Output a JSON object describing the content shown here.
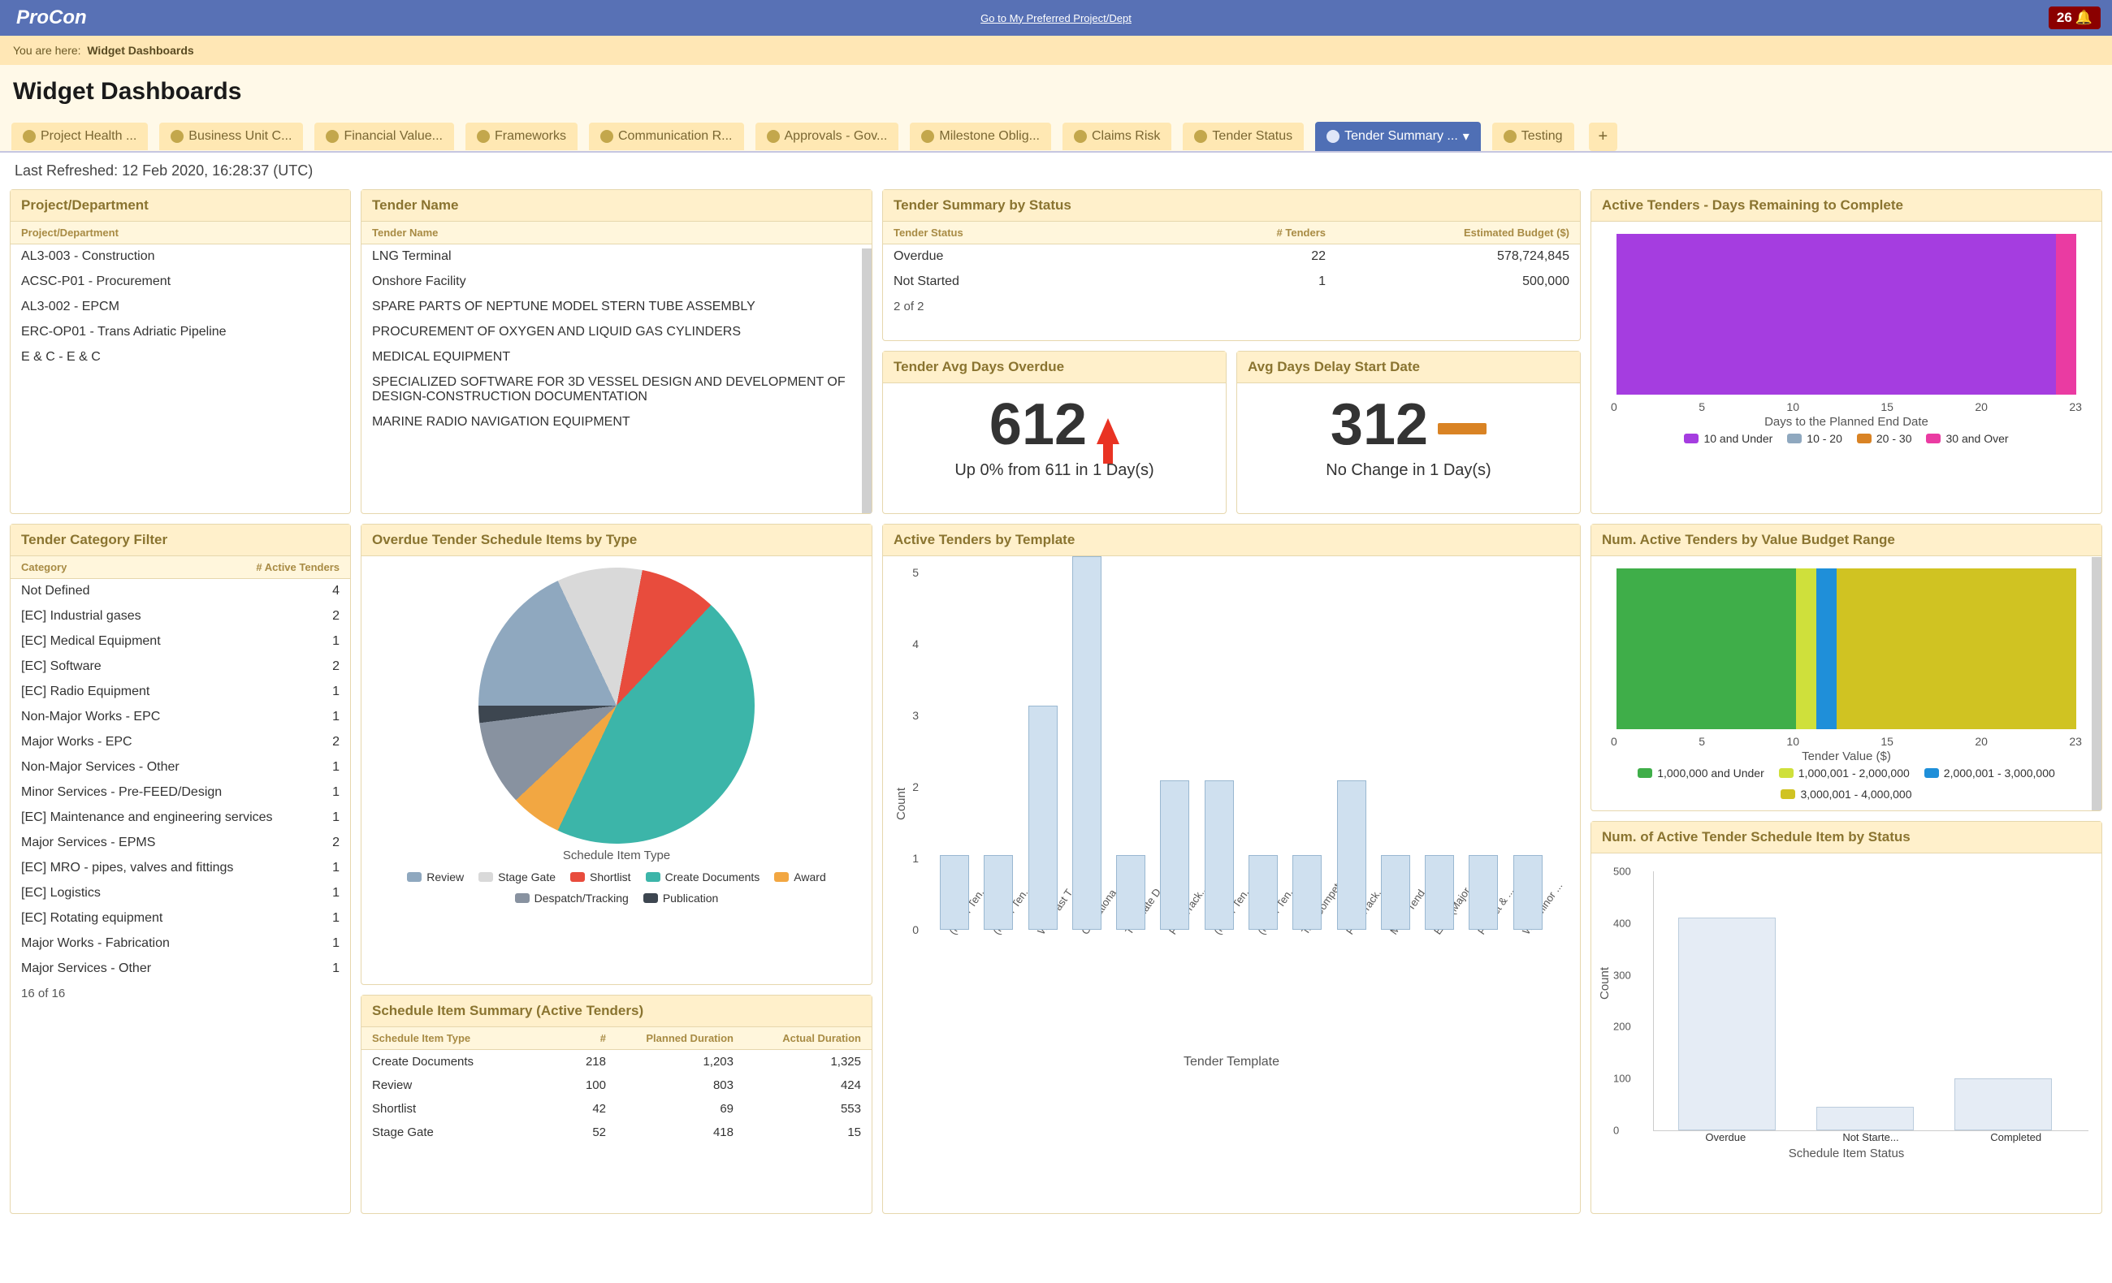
{
  "header": {
    "brand": "ProCon",
    "centerLink": "Go to My Preferred Project/Dept",
    "notifCount": "26"
  },
  "breadcrumb": {
    "prefix": "You are here:",
    "current": "Widget Dashboards"
  },
  "pageTitle": "Widget Dashboards",
  "tabs": [
    {
      "label": "Project Health ..."
    },
    {
      "label": "Business Unit C..."
    },
    {
      "label": "Financial Value..."
    },
    {
      "label": "Frameworks"
    },
    {
      "label": "Communication R..."
    },
    {
      "label": "Approvals - Gov..."
    },
    {
      "label": "Milestone Oblig..."
    },
    {
      "label": "Claims Risk"
    },
    {
      "label": "Tender Status"
    },
    {
      "label": "Tender Summary ...",
      "active": true
    },
    {
      "label": "Testing"
    }
  ],
  "lastRefreshed": "Last Refreshed: 12 Feb 2020, 16:28:37 (UTC)",
  "widgets": {
    "projectDept": {
      "title": "Project/Department",
      "colHeader": "Project/Department",
      "items": [
        "AL3-003 - Construction",
        "ACSC-P01 - Procurement",
        "AL3-002 - EPCM",
        "ERC-OP01 - Trans Adriatic Pipeline",
        "E & C - E & C"
      ]
    },
    "tenderName": {
      "title": "Tender Name",
      "colHeader": "Tender Name",
      "items": [
        "LNG Terminal",
        "Onshore Facility",
        "SPARE PARTS OF NEPTUNE MODEL STERN TUBE ASSEMBLY",
        "PROCUREMENT OF OXYGEN AND LIQUID GAS CYLINDERS",
        "MEDICAL EQUIPMENT",
        "SPECIALIZED SOFTWARE FOR 3D VESSEL DESIGN AND DEVELOPMENT OF DESIGN-CONSTRUCTION DOCUMENTATION",
        "MARINE RADIO NAVIGATION EQUIPMENT"
      ]
    },
    "summaryByStatus": {
      "title": "Tender Summary by Status",
      "cols": [
        "Tender Status",
        "# Tenders",
        "Estimated Budget ($)"
      ],
      "rows": [
        {
          "status": "Overdue",
          "n": "22",
          "budget": "578,724,845"
        },
        {
          "status": "Not Started",
          "n": "1",
          "budget": "500,000"
        }
      ],
      "footer": "2 of 2"
    },
    "avgOverdue": {
      "title": "Tender Avg Days Overdue",
      "value": "612",
      "sub": "Up 0% from 611 in 1 Day(s)"
    },
    "avgDelay": {
      "title": "Avg Days Delay Start Date",
      "value": "312",
      "sub": "No Change in 1 Day(s)"
    },
    "categoryFilter": {
      "title": "Tender Category Filter",
      "cols": [
        "Category",
        "# Active Tenders"
      ],
      "rows": [
        {
          "c": "Not Defined",
          "n": "4"
        },
        {
          "c": "[EC] Industrial gases",
          "n": "2"
        },
        {
          "c": "[EC] Medical Equipment",
          "n": "1"
        },
        {
          "c": "[EC] Software",
          "n": "2"
        },
        {
          "c": "[EC] Radio Equipment",
          "n": "1"
        },
        {
          "c": "Non-Major Works - EPC",
          "n": "1"
        },
        {
          "c": "Major Works - EPC",
          "n": "2"
        },
        {
          "c": "Non-Major Services - Other",
          "n": "1"
        },
        {
          "c": "Minor Services - Pre-FEED/Design",
          "n": "1"
        },
        {
          "c": "[EC] Maintenance and engineering services",
          "n": "1"
        },
        {
          "c": "Major Services - EPMS",
          "n": "2"
        },
        {
          "c": "[EC] MRO - pipes, valves and fittings",
          "n": "1"
        },
        {
          "c": "[EC] Logistics",
          "n": "1"
        },
        {
          "c": "[EC] Rotating equipment",
          "n": "1"
        },
        {
          "c": "Major Works - Fabrication",
          "n": "1"
        },
        {
          "c": "Major Services - Other",
          "n": "1"
        }
      ],
      "footer": "16 of 16"
    },
    "pie": {
      "title": "Overdue Tender Schedule Items by Type",
      "caption": "Schedule Item Type",
      "legend": [
        "Review",
        "Stage Gate",
        "Shortlist",
        "Create Documents",
        "Award",
        "Despatch/Tracking",
        "Publication"
      ]
    },
    "scheduleSummary": {
      "title": "Schedule Item Summary (Active Tenders)",
      "cols": [
        "Schedule Item Type",
        "#",
        "Planned Duration",
        "Actual Duration"
      ],
      "rows": [
        {
          "t": "Create Documents",
          "n": "218",
          "p": "1,203",
          "a": "1,325"
        },
        {
          "t": "Review",
          "n": "100",
          "p": "803",
          "a": "424"
        },
        {
          "t": "Shortlist",
          "n": "42",
          "p": "69",
          "a": "553"
        },
        {
          "t": "Stage Gate",
          "n": "52",
          "p": "418",
          "a": "15"
        }
      ]
    },
    "byTemplate": {
      "title": "Active Tenders by Template",
      "ylabel": "Count",
      "xlabel": "Tender Template"
    },
    "daysRemaining": {
      "title": "Active Tenders - Days Remaining to Complete",
      "xlabel": "Days to the Planned End Date",
      "legend": [
        "10 and Under",
        "10 - 20",
        "20 - 30",
        "30 and Over"
      ]
    },
    "byBudget": {
      "title": "Num. Active Tenders by Value Budget Range",
      "xlabel": "Tender Value ($)",
      "legend": [
        "1,000,000 and Under",
        "1,000,001 - 2,000,000",
        "2,000,001 - 3,000,000",
        "3,000,001 - 4,000,000"
      ]
    },
    "scheduleByStatus": {
      "title": "Num. of Active Tender Schedule Item by Status",
      "ylabel": "Count",
      "xlabel": "Schedule Item Status",
      "cats": [
        "Overdue",
        "Not Starte...",
        "Completed"
      ]
    }
  },
  "chart_data": [
    {
      "type": "pie",
      "title": "Overdue Tender Schedule Items by Type",
      "series": [
        {
          "name": "Review",
          "value": 18,
          "color": "#8fa8bf"
        },
        {
          "name": "Stage Gate",
          "value": 10,
          "color": "#d9d9d9"
        },
        {
          "name": "Shortlist",
          "value": 9,
          "color": "#e84c3d"
        },
        {
          "name": "Create Documents",
          "value": 45,
          "color": "#3cb5a9"
        },
        {
          "name": "Award",
          "value": 6,
          "color": "#f2a742"
        },
        {
          "name": "Despatch/Tracking",
          "value": 10,
          "color": "#8892a0"
        },
        {
          "name": "Publication",
          "value": 2,
          "color": "#3d4650"
        }
      ]
    },
    {
      "type": "bar",
      "title": "Active Tenders by Template",
      "ylabel": "Count",
      "xlabel": "Tender Template",
      "ylim": [
        0,
        5
      ],
      "categories": [
        "(Major Ten...",
        "(Minor Ten...",
        "WP: Fast T...",
        "Operationa...",
        "Template D...",
        "Fast Track...",
        "(Major Ten...",
        "(Minor Ten...",
        "TAP Compet...",
        "Fast Track...",
        "Major Tend...",
        "EPC (Major...",
        "Project & ...",
        "WP: Minor ..."
      ],
      "values": [
        1,
        1,
        3,
        5,
        1,
        2,
        2,
        1,
        1,
        2,
        1,
        1,
        1,
        1
      ]
    },
    {
      "type": "bar",
      "title": "Num. of Active Tender Schedule Item by Status",
      "ylabel": "Count",
      "xlabel": "Schedule Item Status",
      "ylim": [
        0,
        500
      ],
      "categories": [
        "Overdue",
        "Not Started",
        "Completed"
      ],
      "values": [
        410,
        45,
        100
      ]
    },
    {
      "type": "bar",
      "orientation": "stacked-horizontal",
      "title": "Active Tenders - Days Remaining to Complete",
      "xlabel": "Days to the Planned End Date",
      "xlim": [
        0,
        23
      ],
      "series": [
        {
          "name": "10 and Under",
          "value": 22,
          "color": "#a53de0"
        },
        {
          "name": "10 - 20",
          "value": 0,
          "color": "#8fa8bf"
        },
        {
          "name": "20 - 30",
          "value": 0,
          "color": "#d98324"
        },
        {
          "name": "30 and Over",
          "value": 1,
          "color": "#ea3ba2"
        }
      ]
    },
    {
      "type": "bar",
      "orientation": "stacked-horizontal",
      "title": "Num. Active Tenders by Value Budget Range",
      "xlabel": "Tender Value ($)",
      "xlim": [
        0,
        23
      ],
      "series": [
        {
          "name": "1,000,000 and Under",
          "value": 9,
          "color": "#3fae49"
        },
        {
          "name": "1,000,001 - 2,000,000",
          "value": 1,
          "color": "#cfe03b"
        },
        {
          "name": "2,000,001 - 3,000,000",
          "value": 1,
          "color": "#1f8fd9"
        },
        {
          "name": "3,000,001 - 4,000,000",
          "value": 12,
          "color": "#d0c322"
        }
      ]
    }
  ]
}
